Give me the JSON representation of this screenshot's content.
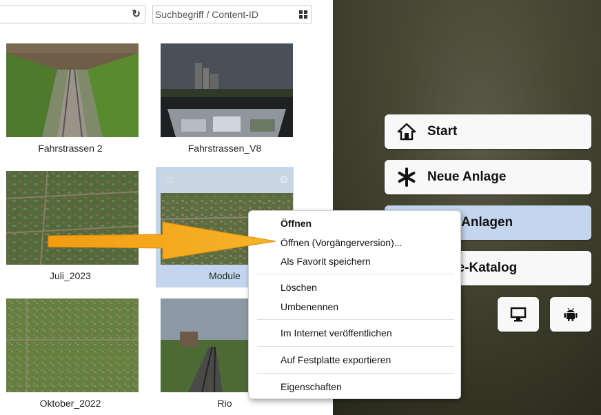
{
  "toolbar": {
    "filter_value": "",
    "refresh_icon": "refresh-icon",
    "search_placeholder": "Suchbegriff / Content-ID",
    "grid_icon": "grid-view-icon"
  },
  "tiles": [
    {
      "label": "Fahrstrassen 2",
      "selected": false
    },
    {
      "label": "Fahrstrassen_V8",
      "selected": false
    },
    {
      "label": "Juli_2023",
      "selected": false
    },
    {
      "label": "Module",
      "selected": true
    },
    {
      "label": "Oktober_2022",
      "selected": false
    },
    {
      "label": "Rio",
      "selected": false
    }
  ],
  "tile_icons": {
    "favorite": "star-icon",
    "settings": "gear-icon"
  },
  "nav": {
    "start": "Start",
    "new_layout": "Neue Anlage",
    "my_layouts": "e Anlagen",
    "catalog": "ne-Katalog"
  },
  "nav_icons": [
    "home-icon",
    "asterisk-icon",
    "desktop-icon",
    "android-icon"
  ],
  "context_menu": {
    "items": [
      "Öffnen",
      "Öffnen (Vorgängerversion)...",
      "Als Favorit speichern",
      "Löschen",
      "Umbenennen",
      "Im Internet veröffentlichen",
      "Auf Festplatte exportieren",
      "Eigenschaften"
    ]
  },
  "colors": {
    "selection": "#c3d6ee",
    "arrow": "#f39c12",
    "background_right": "#43432f"
  }
}
